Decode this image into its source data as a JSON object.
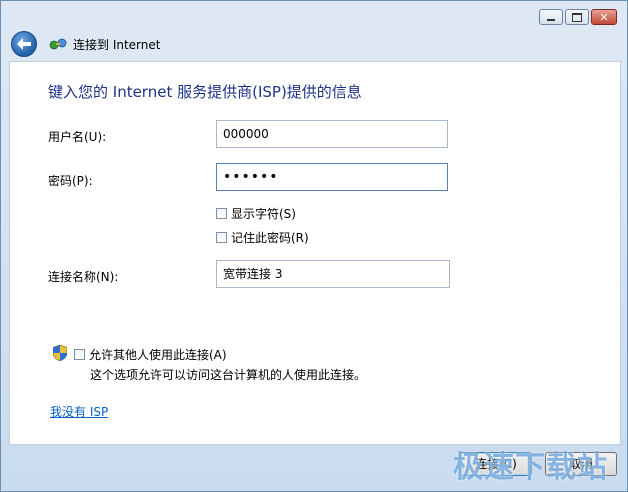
{
  "header": {
    "title": "连接到 Internet"
  },
  "window_controls": {
    "close_glyph": "✕"
  },
  "form": {
    "heading": "键入您的 Internet 服务提供商(ISP)提供的信息",
    "username_label": "用户名(U):",
    "username_value": "000000",
    "password_label": "密码(P):",
    "password_value": "••••••",
    "show_chars_label": "显示字符(S)",
    "remember_label": "记住此密码(R)",
    "conn_name_label": "连接名称(N):",
    "conn_name_value": "宽带连接 3",
    "allow_others_label": "允许其他人使用此连接(A)",
    "allow_others_desc": "这个选项允许可以访问这台计算机的人使用此连接。",
    "no_isp_link": "我没有 ISP"
  },
  "buttons": {
    "connect_label": "连接(C)",
    "cancel_label": "取消"
  },
  "watermark": "极速下载站",
  "icons": {
    "back": "back-arrow-icon",
    "connection": "network-connection-icon",
    "shield": "uac-shield-icon"
  },
  "colors": {
    "heading": "#1e3287",
    "link": "#0b5ec7",
    "frame": "#c9dbef"
  }
}
